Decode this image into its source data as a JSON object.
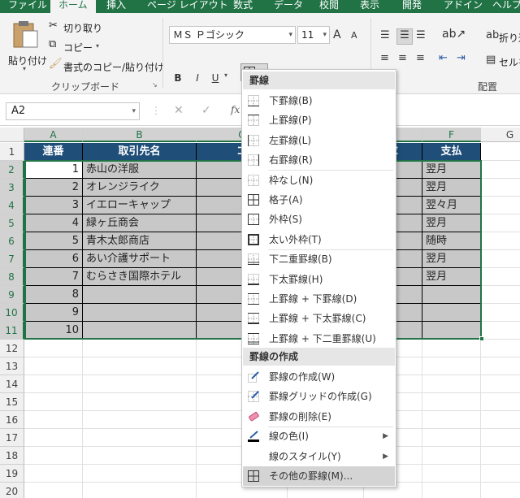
{
  "tabs": [
    {
      "label": "ファイル"
    },
    {
      "label": "ホーム",
      "active": true
    },
    {
      "label": "挿入"
    },
    {
      "label": "ページ レイアウト"
    },
    {
      "label": "数式"
    },
    {
      "label": "データ"
    },
    {
      "label": "校閲"
    },
    {
      "label": "表示"
    },
    {
      "label": "開発"
    },
    {
      "label": "アドイン"
    },
    {
      "label": "ヘルプ"
    }
  ],
  "clipboard": {
    "paste": "貼り付け",
    "cut": "切り取り",
    "copy": "コピー",
    "format_painter": "書式のコピー/貼り付け",
    "group": "クリップボード"
  },
  "font": {
    "name": "ＭＳ Ｐゴシック",
    "size": "11",
    "bold": "B",
    "italic": "I",
    "underline": "U",
    "grow": "A",
    "shrink": "A",
    "color_letter": "A"
  },
  "alignment": {
    "wrap_label": "折り返",
    "merge_label": "セルを",
    "group": "配置"
  },
  "colors": {
    "excel_green": "#217346",
    "header_fill": "#1f4e79",
    "data_fill": "#c8c8c8",
    "font_color_bar": "#e00000"
  },
  "namebox": {
    "value": "A2"
  },
  "formula_bar": {
    "cancel": "✕",
    "enter": "✓",
    "fx": "fx"
  },
  "columns": [
    "A",
    "B",
    "C",
    "D",
    "E",
    "F",
    "G"
  ],
  "rows": [
    "1",
    "2",
    "3",
    "4",
    "5",
    "6",
    "7",
    "8",
    "9",
    "10",
    "11",
    "12",
    "13",
    "14",
    "15",
    "16",
    "17",
    "18",
    "19",
    "20"
  ],
  "sheet": {
    "headers": {
      "a": "連番",
      "b": "取引先名",
      "c": "コ",
      "e": "求",
      "f": "支払"
    },
    "rows": [
      {
        "num": "1",
        "name": "赤山の洋服",
        "e": "末",
        "f": "翌月"
      },
      {
        "num": "2",
        "name": "オレンジライク",
        "e": "0",
        "f": "翌月"
      },
      {
        "num": "3",
        "name": "イエローキャップ",
        "e": "末",
        "f": "翌々月"
      },
      {
        "num": "4",
        "name": "緑ヶ丘商会",
        "e": "0",
        "f": "翌月"
      },
      {
        "num": "5",
        "name": "青木太郎商店",
        "e": "時",
        "f": "随時"
      },
      {
        "num": "6",
        "name": "あい介護サポート",
        "e": "末",
        "f": "翌月"
      },
      {
        "num": "7",
        "name": "むらさき国際ホテル",
        "e": "末",
        "f": "翌月"
      },
      {
        "num": "8",
        "name": "",
        "e": "",
        "f": ""
      },
      {
        "num": "9",
        "name": "",
        "e": "",
        "f": ""
      },
      {
        "num": "10",
        "name": "",
        "e": "",
        "f": ""
      }
    ]
  },
  "border_menu": {
    "section_borders": "罫線",
    "items_top": [
      {
        "label": "下罫線(B)",
        "icon": "border-bottom-icon"
      },
      {
        "label": "上罫線(P)",
        "icon": "border-top-icon"
      },
      {
        "label": "左罫線(L)",
        "icon": "border-left-icon"
      },
      {
        "label": "右罫線(R)",
        "icon": "border-right-icon"
      },
      {
        "label": "枠なし(N)",
        "icon": "no-border-icon"
      },
      {
        "label": "格子(A)",
        "icon": "all-borders-icon"
      },
      {
        "label": "外枠(S)",
        "icon": "outside-borders-icon"
      },
      {
        "label": "太い外枠(T)",
        "icon": "thick-box-border-icon"
      },
      {
        "label": "下二重罫線(B)",
        "icon": "bottom-double-border-icon"
      },
      {
        "label": "下太罫線(H)",
        "icon": "thick-bottom-border-icon"
      },
      {
        "label": "上罫線 + 下罫線(D)",
        "icon": "top-bottom-border-icon"
      },
      {
        "label": "上罫線 + 下太罫線(C)",
        "icon": "top-thick-bottom-border-icon"
      },
      {
        "label": "上罫線 + 下二重罫線(U)",
        "icon": "top-double-bottom-border-icon"
      }
    ],
    "section_draw": "罫線の作成",
    "items_draw": [
      {
        "label": "罫線の作成(W)",
        "icon": "draw-border-icon"
      },
      {
        "label": "罫線グリッドの作成(G)",
        "icon": "draw-border-grid-icon"
      },
      {
        "label": "罫線の削除(E)",
        "icon": "eraser-icon"
      },
      {
        "label": "線の色(I)",
        "icon": "line-color-icon"
      },
      {
        "label": "線のスタイル(Y)",
        "icon": "line-style-icon"
      },
      {
        "label": "その他の罫線(M)...",
        "icon": "more-borders-icon"
      }
    ]
  }
}
